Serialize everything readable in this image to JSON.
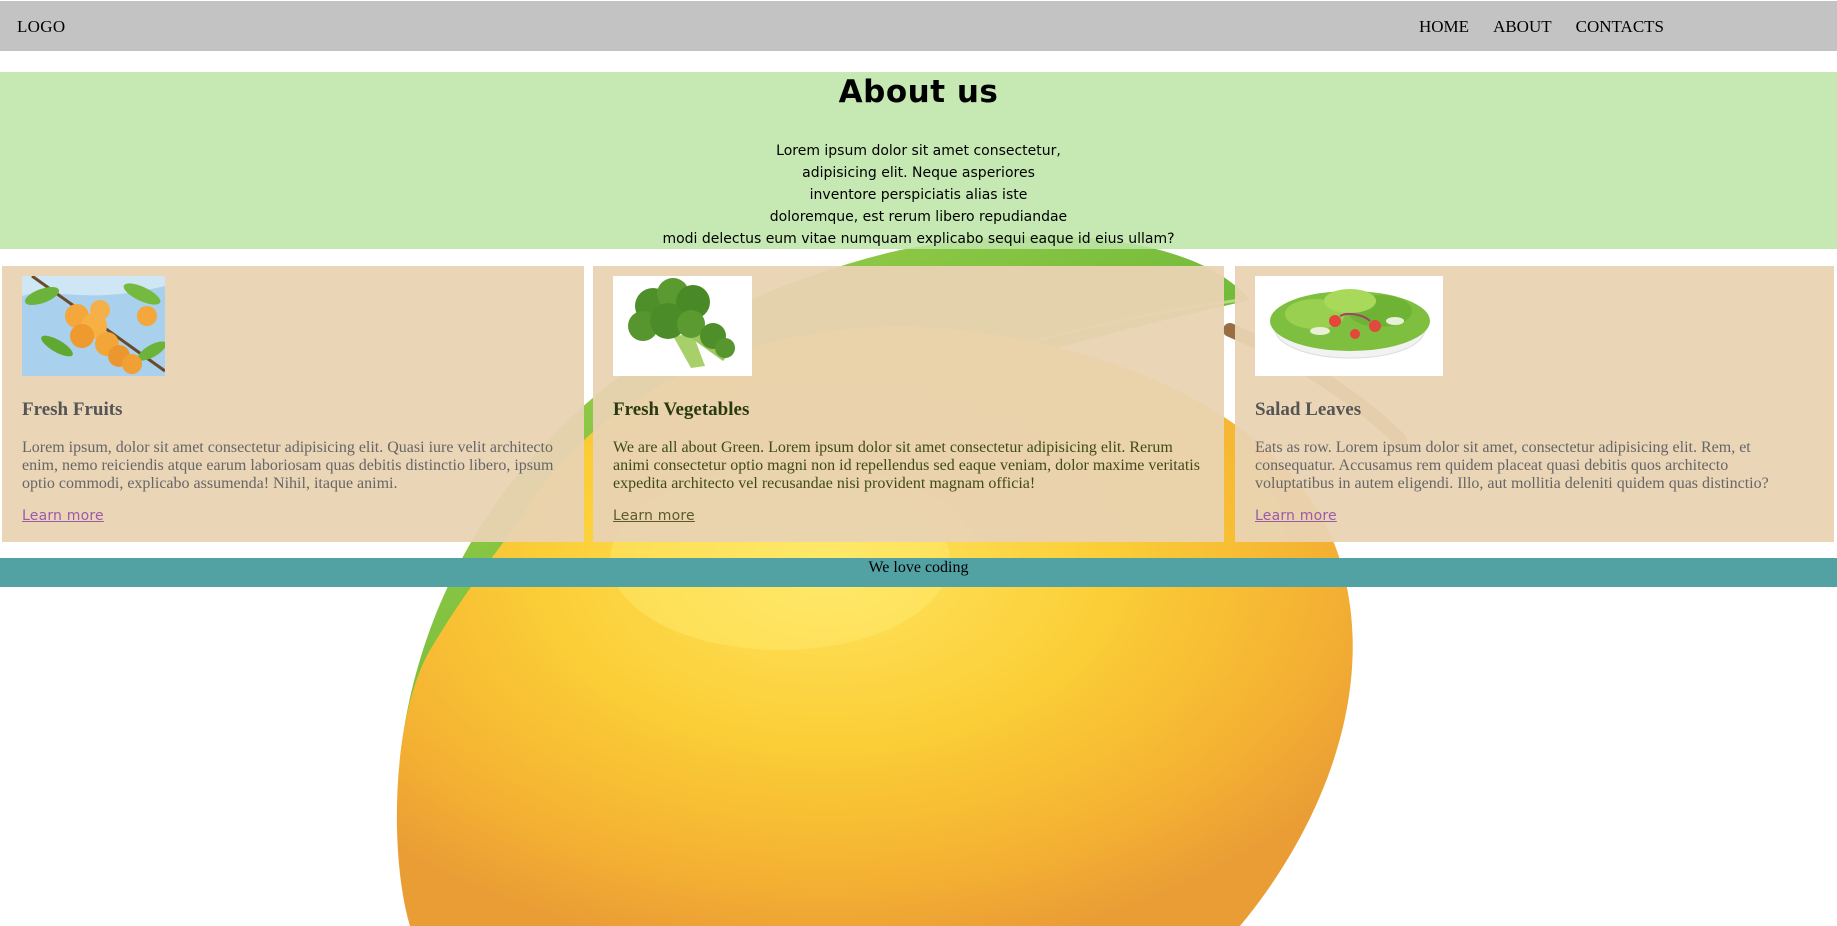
{
  "nav": {
    "logo": "LOGO",
    "links": [
      "HOME",
      "ABOUT",
      "CONTACTS"
    ]
  },
  "about": {
    "title": "About us",
    "lines": [
      "Lorem ipsum dolor sit amet consectetur,",
      "adipisicing elit. Neque asperiores",
      "inventore perspiciatis alias iste",
      "doloremque, est rerum libero repudiandae",
      "modi delectus eum vitae numquam explicabo sequi eaque id eius ullam?"
    ]
  },
  "cards": [
    {
      "title": "Fresh Fruits",
      "text": "Lorem ipsum, dolor sit amet consectetur adipisicing elit. Quasi iure velit architecto enim, nemo reiciendis atque earum laboriosam quas debitis distinctio libero, ipsum optio commodi, explicabo assumenda! Nihil, itaque animi.",
      "link": "Learn more"
    },
    {
      "title": "Fresh Vegetables",
      "text": "We are all about Green. Lorem ipsum dolor sit amet consectetur adipisicing elit. Rerum animi consectetur optio magni non id repellendus sed eaque veniam, dolor maxime veritatis expedita architecto vel recusandae nisi provident magnam officia!",
      "link": "Learn more"
    },
    {
      "title": "Salad Leaves",
      "text": "Eats as row. Lorem ipsum dolor sit amet, consectetur adipisicing elit. Rem, et consequatur. Accusamus rem quidem placeat quasi debitis quos architecto voluptatibus in autem eligendi. Illo, aut mollitia deleniti quidem quas distinctio?",
      "link": "Learn more"
    }
  ],
  "footer": {
    "text": "We love coding"
  },
  "colors": {
    "navbar": "#c3c3c3",
    "about_bg": "#bee5a8",
    "card_bg": "#e9d3b2",
    "footer_bg": "#52a1a3",
    "link": "#9a5ba8"
  },
  "icons": {
    "background": "mango-illustration",
    "card_images": [
      "apricot-image",
      "broccoli-image",
      "salad-image"
    ]
  }
}
